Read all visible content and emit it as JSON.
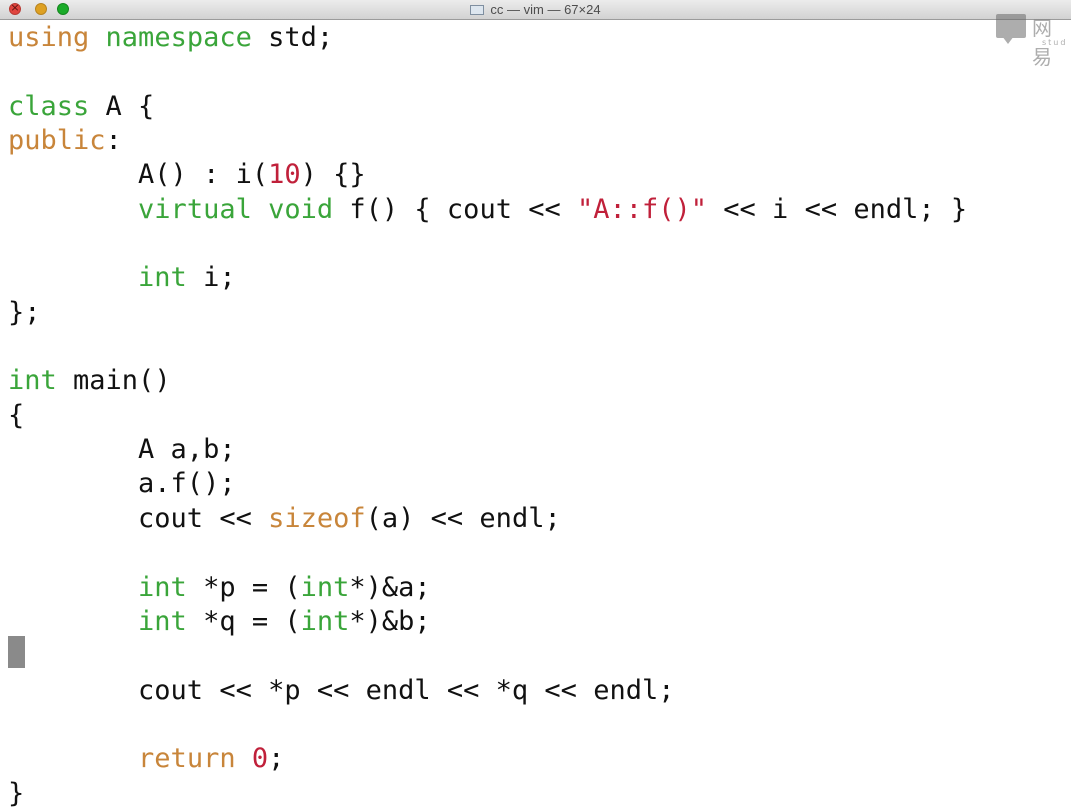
{
  "window": {
    "title": "cc — vim — 67×24",
    "watermark": {
      "text": "网易",
      "subtext": "stud"
    }
  },
  "editor": {
    "lines": [
      [
        {
          "t": "using",
          "c": "orange"
        },
        {
          "t": " "
        },
        {
          "t": "namespace",
          "c": "green"
        },
        {
          "t": " std;"
        }
      ],
      [],
      [
        {
          "t": "class",
          "c": "green"
        },
        {
          "t": " A {"
        }
      ],
      [
        {
          "t": "public",
          "c": "orange"
        },
        {
          "t": ":"
        }
      ],
      [
        {
          "t": "        A() : i("
        },
        {
          "t": "10",
          "c": "red"
        },
        {
          "t": ") {}"
        }
      ],
      [
        {
          "t": "        "
        },
        {
          "t": "virtual",
          "c": "green"
        },
        {
          "t": " "
        },
        {
          "t": "void",
          "c": "green"
        },
        {
          "t": " f() { cout << "
        },
        {
          "t": "\"A::f()\"",
          "c": "red"
        },
        {
          "t": " << i << endl; }"
        }
      ],
      [],
      [
        {
          "t": "        "
        },
        {
          "t": "int",
          "c": "green"
        },
        {
          "t": " i;"
        }
      ],
      [
        {
          "t": "};"
        }
      ],
      [],
      [
        {
          "t": "int",
          "c": "green"
        },
        {
          "t": " main()"
        }
      ],
      [
        {
          "t": "{"
        }
      ],
      [
        {
          "t": "        A a,b;"
        }
      ],
      [
        {
          "t": "        a.f();"
        }
      ],
      [
        {
          "t": "        cout << "
        },
        {
          "t": "sizeof",
          "c": "orange"
        },
        {
          "t": "(a) << endl;"
        }
      ],
      [],
      [
        {
          "t": "        "
        },
        {
          "t": "int",
          "c": "green"
        },
        {
          "t": " *p = ("
        },
        {
          "t": "int",
          "c": "green"
        },
        {
          "t": "*)&a;"
        }
      ],
      [
        {
          "t": "        "
        },
        {
          "t": "int",
          "c": "green"
        },
        {
          "t": " *q = ("
        },
        {
          "t": "int",
          "c": "green"
        },
        {
          "t": "*)&b;"
        }
      ],
      [],
      [
        {
          "t": "        cout << *p << endl << *q << endl;"
        }
      ],
      [],
      [
        {
          "t": "        "
        },
        {
          "t": "return",
          "c": "orange"
        },
        {
          "t": " "
        },
        {
          "t": "0",
          "c": "red"
        },
        {
          "t": ";"
        }
      ],
      [
        {
          "t": "}"
        }
      ]
    ]
  },
  "colors": {
    "keyword_green": "#3aa53a",
    "keyword_orange": "#c8853a",
    "literal_red": "#c0203a",
    "text": "#111111",
    "cursor": "#8a8a8a"
  }
}
